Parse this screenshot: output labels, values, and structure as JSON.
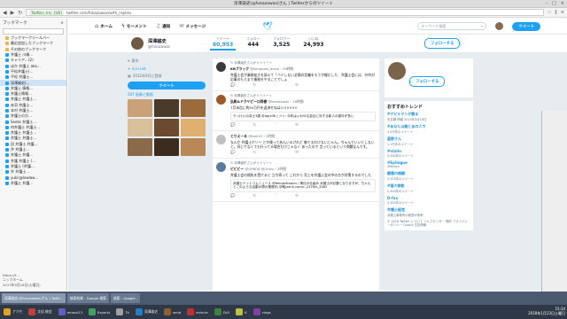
{
  "window": {
    "title": "深澤諭史(@fukazawas)さん | Twitterからのツイート"
  },
  "browser": {
    "security": "Twitter, Inc. [US]",
    "url": "twitter.com/fukazawas/with_replies"
  },
  "sidebar": {
    "title": "ブックマーク",
    "items": [
      {
        "label": "ブックマークツールバー",
        "type": "folder"
      },
      {
        "label": "最近追加したブックマーク",
        "type": "folder"
      },
      {
        "label": "その他のブックマーク",
        "type": "folder"
      },
      {
        "label": "弁護士 川端…",
        "type": "item"
      },
      {
        "label": "キャリア…(2)",
        "type": "item"
      },
      {
        "label": "ほか 弁護士 aka…",
        "type": "item"
      },
      {
        "label": "平松弁護士(…",
        "type": "item"
      },
      {
        "label": "平松 弁護士…",
        "type": "item"
      },
      {
        "label": "深澤諭史(…",
        "type": "item"
      },
      {
        "label": "弁護士 情報…",
        "type": "item"
      },
      {
        "label": "弁護士情報…",
        "type": "item"
      },
      {
        "label": "弁護士 弁護士…",
        "type": "item"
      },
      {
        "label": "赤羽 弁護士…",
        "type": "item"
      },
      {
        "label": "本村 弁護士…",
        "type": "item"
      },
      {
        "label": "弁護士の方…",
        "type": "item"
      },
      {
        "label": "Seeks 弁護士…",
        "type": "item"
      },
      {
        "label": "何弁護士 弁護士…",
        "type": "item"
      },
      {
        "label": "弁護士 弁護士…",
        "type": "item"
      },
      {
        "label": "弁護士 弁護士…",
        "type": "item"
      },
      {
        "label": "田 弁護士 弁護…",
        "type": "item"
      },
      {
        "label": "弁 弁護士…",
        "type": "item"
      },
      {
        "label": "弁護士 弁護…",
        "type": "item"
      },
      {
        "label": "弁護 弁護士 (…",
        "type": "item"
      },
      {
        "label": "弁護士 (弁護…",
        "type": "item"
      },
      {
        "label": "弁 弁護士…",
        "type": "item"
      },
      {
        "label": "yuki(@lawlaw…",
        "type": "item"
      },
      {
        "label": "弁護士 弁護…",
        "type": "item"
      }
    ],
    "bottom": {
      "url": "https://t…",
      "user": "ニックネーム",
      "date": "2017年5月18日(火曜日)"
    }
  },
  "twitter": {
    "nav": [
      "ホーム",
      "モーメント",
      "通知",
      "メッセージ"
    ],
    "search_placeholder": "キーワード検索",
    "tweet_button": "ツイート",
    "profile": {
      "name": "深澤諭史",
      "handle": "@fukazawas",
      "location": "東京",
      "web": "b.in.net",
      "joined": "2012年9月に登録"
    },
    "stats": [
      {
        "label": "ツイート",
        "value": "60,953"
      },
      {
        "label": "フォロー",
        "value": "444"
      },
      {
        "label": "フォロワー",
        "value": "3,525"
      },
      {
        "label": "いいね",
        "value": "24,993"
      }
    ],
    "follow_button": "フォローする",
    "media_label": "287 画像と動画",
    "timeline": [
      {
        "rt": "深澤諭史さんがリツイート",
        "name": "KBブラック",
        "handle": "@kengoshi_black・29時間",
        "body": "弁護士会が業務拡大を訴えて「ベイしない全損の定義をもうが緩むした、弁護士会には、外弁対応事のもとまで業務をやることでしょ"
      },
      {
        "rt": "深澤諭史さんがリツイート",
        "name": "弘彰&ドクヤピーロ同僚",
        "handle": "@kenalkashi・18時間",
        "body": "7月末迄に約50万円を返済せねばい!!!!!!!!!!",
        "quote": "りっけいの弁士3歳 @ippy08 / ツイ: 今年はいわゆる会社に対する新人の認可が多い"
      },
      {
        "rt": "",
        "name": "とりえーる",
        "handle": "@torii03・2時間",
        "body": "なんか 弁護士ポリー とか僕ってあんいるけれど 勝てるわけないじゃん。ちゃんでいいとしないと。同じでなくても行ってる場合だけじゃなく あったので 言っているという問題なんです。"
      },
      {
        "rt": "深澤諭史さんがリツイート",
        "name": "ビビビー",
        "handle": "@OPBO8 @Ohisu・2時間",
        "body": "弁護士会の損失を受けると 立ち寄って これから 売上を弁護士会の中の方が対策するのでした",
        "quote": "弁護士ドットコムニュース @bengo4topics / 神社の仕組み 弁護士が必要となりますが、ちゃんとこのような活動の際の業務を(中略)zen4.com/c_2378/h_2082"
      }
    ],
    "follow_card": {
      "button": "フォローする"
    },
    "trends_title": "おすすめトレンド",
    "trends": [
      {
        "tag": "#デビルマンが観る",
        "desc": "天井棚 情報 2014年3月18日"
      },
      {
        "tag": "#あなたは誰とあの人で",
        "desc": "3.5万件のツイート"
      },
      {
        "tag": "星野さん",
        "desc": "1.1万件のツイート"
      },
      {
        "tag": "#stalin",
        "desc": "5,000件のツイート"
      },
      {
        "tag": "#Epilogue",
        "desc": "Telecom"
      },
      {
        "tag": "慶應の閉鎖",
        "desc": "5,525件のツイート"
      },
      {
        "tag": "#猫大移動",
        "desc": "2,900件のツイート"
      },
      {
        "tag": "D-fax",
        "desc": "4,355件のツイート"
      },
      {
        "tag": "弁護士経営",
        "desc": "弁護士事務所の経営が参考"
      }
    ],
    "footer": "© 2018 Twitter について ヘルプセンター 規約 プライバシーポリシー Cookie 広告情報"
  },
  "taskbar": [
    "深澤諭史(@fukazawas)さん | Twitt…",
    "検索結果 - Google 検索",
    "検索 - Google -"
  ],
  "dock": [
    "アクセ",
    "文化 総会",
    "emacs23",
    "Exports",
    "Tk",
    "深澤諭史",
    "wmd",
    "evincie",
    "Ds3",
    "K",
    "vlogs"
  ],
  "clock": {
    "time": "15:34",
    "date": "2018年1月13日土曜日"
  },
  "colors": {
    "accent": "#1da1f2",
    "bg": "#e6ecf0"
  }
}
